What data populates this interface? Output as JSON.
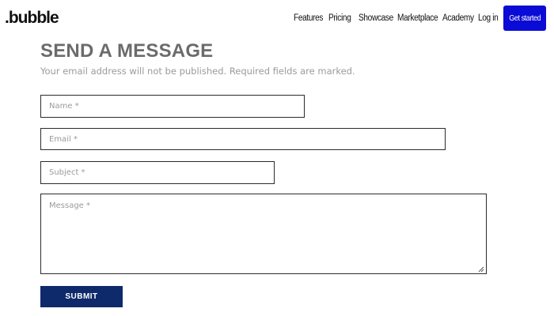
{
  "header": {
    "logo_text": ".bubble",
    "nav": {
      "features": "Features",
      "pricing": "Pricing",
      "showcase": "Showcase",
      "marketplace": "Marketplace",
      "academy": "Academy",
      "login": "Log in"
    },
    "cta_label": "Get started",
    "cta_color": "#0b0bd6"
  },
  "form": {
    "title": "SEND A MESSAGE",
    "subtitle": "Your email address will not be published. Required fields are marked.",
    "name_placeholder": "Name *",
    "email_placeholder": "Email *",
    "subject_placeholder": "Subject *",
    "message_placeholder": "Message *",
    "submit_label": "SUBMIT",
    "submit_color": "#0e2a6b"
  },
  "icons": {
    "resize_grip": "resize-grip-icon"
  }
}
